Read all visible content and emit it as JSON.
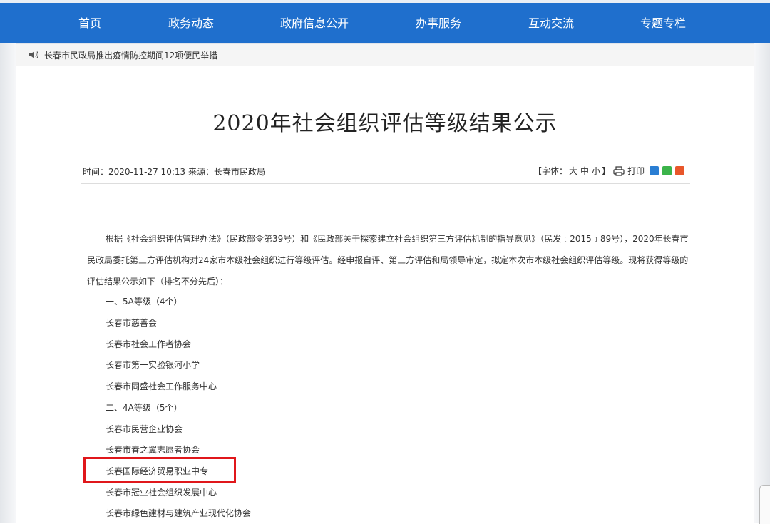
{
  "nav": {
    "items": [
      "首页",
      "政务动态",
      "政府信息公开",
      "办事服务",
      "互动交流",
      "专题专栏"
    ]
  },
  "notice": {
    "icon": "speaker-icon",
    "text": "长春市民政局推出疫情防控期间12项便民举措"
  },
  "article": {
    "title": "2020年社会组织评估等级结果公示",
    "meta": "时间：2020-11-27 10:13  来源：长春市民政局",
    "font_label": "【字体：",
    "font_large": "大",
    "font_medium": "中",
    "font_small": "小",
    "font_close": "】",
    "print_label": "打印",
    "intro": "根据《社会组织评估管理办法》（民政部令第39号）和《民政部关于探索建立社会组织第三方评估机制的指导意见》（民发﹝2015﹞89号），2020年长春市民政局委托第三方评估机构对24家市本级社会组织进行等级评估。经申报自评、第三方评估和局领导审定，拟定本次市本级社会组织评估等级。现将获得等级的评估结果公示如下（排名不分先后）：",
    "lines": [
      "一、5A等级（4个）",
      "长春市慈善会",
      "长春市社会工作者协会",
      "长春市第一实验银河小学",
      "长春市同盛社会工作服务中心",
      "二、4A等级（5个）",
      "长春市民营企业协会",
      "长春市春之翼志愿者协会",
      "长春国际经济贸易职业中专",
      "长春市冠业社会组织发展中心",
      "长春市绿色建材与建筑产业现代化协会"
    ]
  },
  "colors": {
    "nav_bg": "#1f6fcd",
    "highlight_border": "#e0171b",
    "qq_icon": "#2a7ed3",
    "wechat_icon": "#3bb34a",
    "weibo_icon": "#e8562a"
  },
  "share_icons": [
    "qq-icon",
    "wechat-icon",
    "weibo-icon"
  ]
}
